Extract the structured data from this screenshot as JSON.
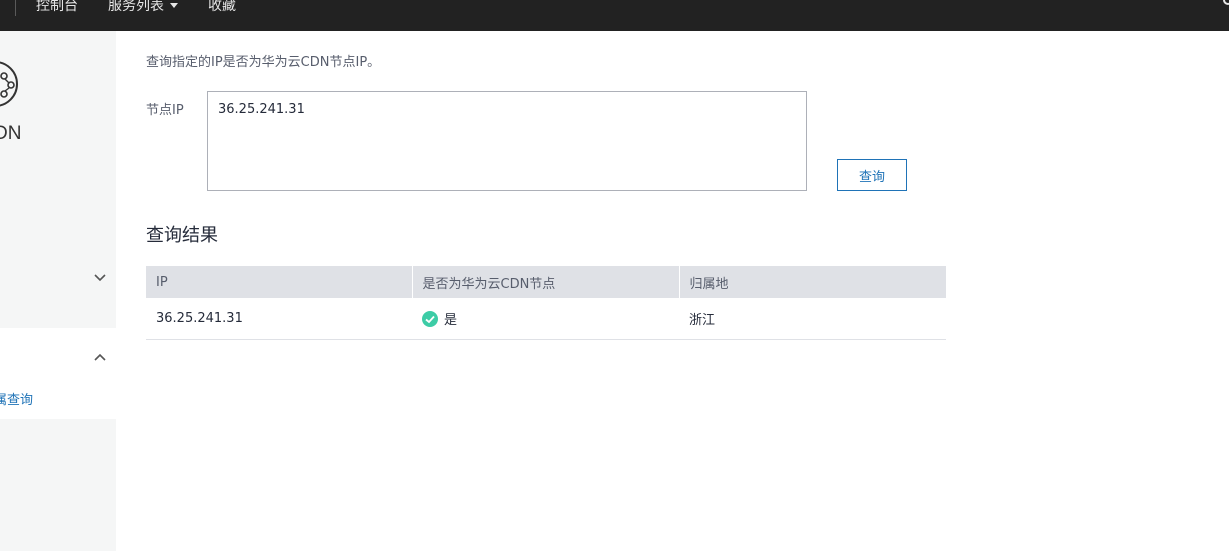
{
  "topbar": {
    "nav": [
      {
        "label": "控制台"
      },
      {
        "label": "服务列表"
      },
      {
        "label": "收藏"
      }
    ]
  },
  "sidebar": {
    "logo_text": "DN",
    "active_item": "属查询"
  },
  "main": {
    "description": "查询指定的IP是否为华为云CDN节点IP。",
    "field_label": "节点IP",
    "ip_input_value": "36.25.241.31",
    "query_button_label": "查询",
    "results_title": "查询结果",
    "table": {
      "headers": [
        "IP",
        "是否为华为云CDN节点",
        "归属地"
      ],
      "rows": [
        {
          "ip": "36.25.241.31",
          "is_cdn": "是",
          "location": "浙江"
        }
      ]
    }
  },
  "colors": {
    "topbar_bg": "#222222",
    "accent": "#1f73b7",
    "success": "#3dcca6",
    "table_header_bg": "#dfe1e6"
  }
}
